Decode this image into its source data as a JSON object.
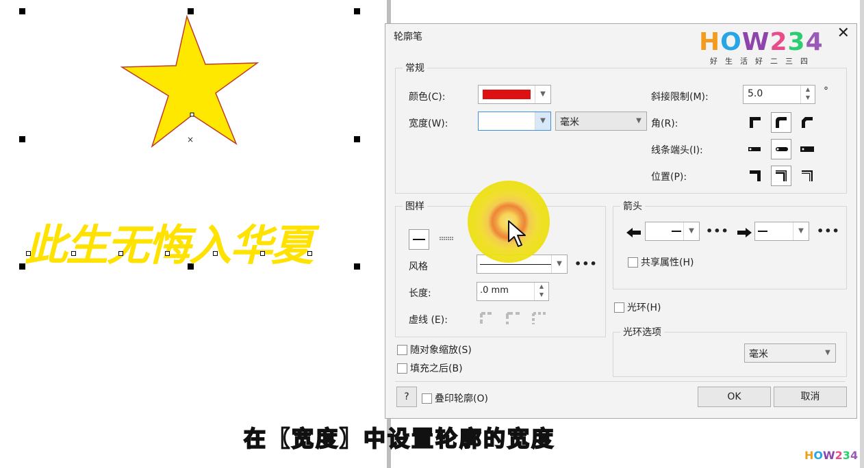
{
  "canvas": {
    "art_text": "此生无悔入华夏",
    "star_fill": "#ffe800",
    "star_stroke": "#c0392b"
  },
  "dialog": {
    "title": "轮廓笔",
    "close": "✕",
    "logo": {
      "word": "HOW234",
      "sub": "好生活好二三四"
    },
    "general": {
      "legend": "常规",
      "color_label": "颜色(C):",
      "color_value": "#dd1111",
      "width_label": "宽度(W):",
      "width_value": "",
      "unit_value": "毫米",
      "miter_label": "斜接限制(M):",
      "miter_value": "5.0",
      "miter_unit": "°",
      "corner_label": "角(R):",
      "linecap_label": "线条端头(I):",
      "position_label": "位置(P):"
    },
    "pattern": {
      "legend": "图样",
      "style_label": "风格",
      "length_label": "长度:",
      "length_value": ".0 mm",
      "dash_label": "虚线 (E):"
    },
    "arrows": {
      "legend": "箭头",
      "share_label": "共享属性(H)"
    },
    "halo_label": "光环(H)",
    "halo_options": {
      "legend": "光环选项",
      "unit_value": "毫米"
    },
    "scale_label": "随对象缩放(S)",
    "fill_behind_label": "填充之后(B)",
    "help_label": "?",
    "overprint_label": "叠印轮廓(O)",
    "ok_label": "OK",
    "cancel_label": "取消"
  },
  "subtitle": "在【宽度】中设置轮廓的宽度",
  "watermark": "HOW234",
  "colors": {
    "logo_h": "#f29c1f",
    "logo_o": "#27a5e4",
    "logo_w": "#8e44ad",
    "logo_2": "#e84c8b",
    "logo_3": "#2ecc71",
    "logo_4": "#9b59b6"
  }
}
